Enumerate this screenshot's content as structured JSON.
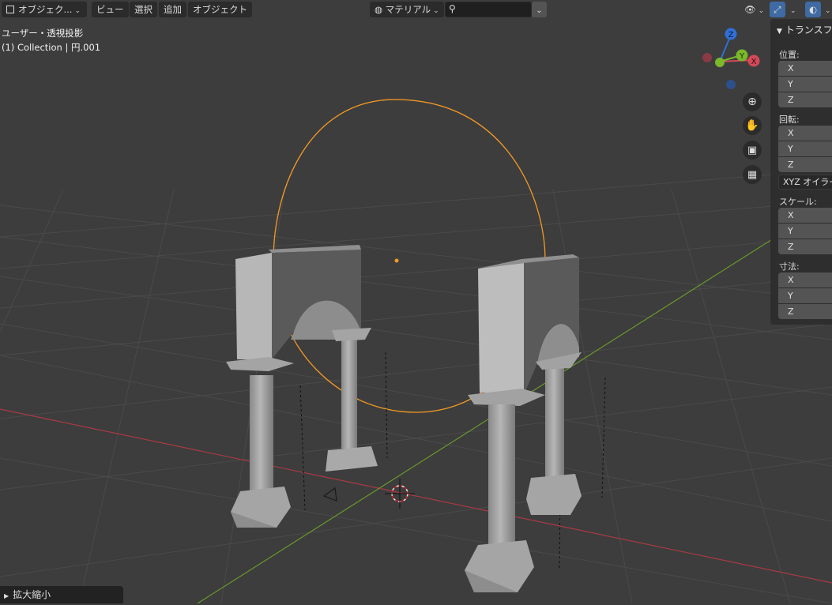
{
  "header": {
    "mode_label": "オブジェク...",
    "menus": [
      "ビュー",
      "選択",
      "追加",
      "オブジェクト"
    ],
    "shading_label": "マテリアル",
    "search_value": ""
  },
  "overlay": {
    "view_name": "ユーザー・透視投影",
    "collection_info": "(1) Collection | 円.001"
  },
  "gizmo": {
    "x": "X",
    "y": "Y",
    "z": "Z"
  },
  "nav_tools": [
    "zoom-icon",
    "hand-pan-icon",
    "camera-icon",
    "grid-ortho-icon"
  ],
  "npanel": {
    "title": "トランスフ",
    "location_label": "位置:",
    "rotation_label": "回転:",
    "rotation_mode": "XYZ オイラー",
    "scale_label": "スケール:",
    "dimensions_label": "寸法:",
    "axes": [
      "X",
      "Y",
      "Z"
    ]
  },
  "operator_panel": {
    "label": "拡大縮小"
  },
  "colors": {
    "x_axis": "#d24a58",
    "y_axis": "#7ab82c",
    "z_axis": "#2f6fd6",
    "selection": "#f59a23",
    "viewport_bg": "#3d3d3d"
  }
}
